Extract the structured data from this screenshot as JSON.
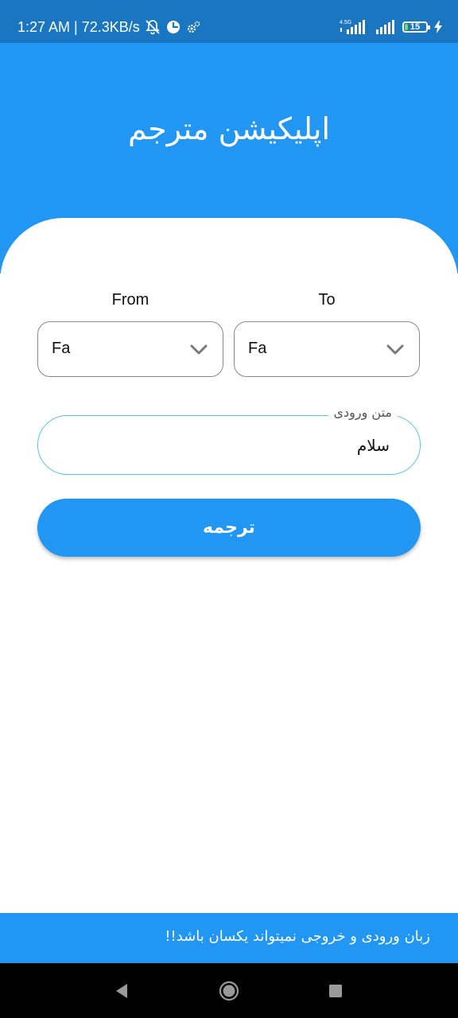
{
  "status_bar": {
    "time_and_speed": "1:27 AM | 72.3KB/s",
    "network_label": "4.5G",
    "battery_level": "15",
    "battery_fraction": 0.15
  },
  "header": {
    "title": "اپلیکیشن مترجم"
  },
  "languages": {
    "from": {
      "label": "From",
      "selected": "Fa"
    },
    "to": {
      "label": "To",
      "selected": "Fa"
    }
  },
  "input": {
    "label": "متن ورودی",
    "value": "سلام"
  },
  "translate_button": {
    "label": "ترجمه"
  },
  "snackbar": {
    "message": "زبان ورودی و خروجی نمیتواند یکسان باشد!!"
  },
  "colors": {
    "primary": "#2196f3",
    "status_bar": "#1b76c2",
    "input_border": "#5bc3e8",
    "dropdown_border": "#8a8a8a"
  },
  "icons": {
    "status_left": [
      "notifications-off-icon",
      "data-saver-icon",
      "settings-icon"
    ],
    "status_right": [
      "signal-4g-icon",
      "signal-icon",
      "battery-icon",
      "charging-icon"
    ],
    "dropdown": "chevron-down-icon",
    "navigation": [
      "back-icon",
      "home-icon",
      "recents-icon"
    ]
  }
}
